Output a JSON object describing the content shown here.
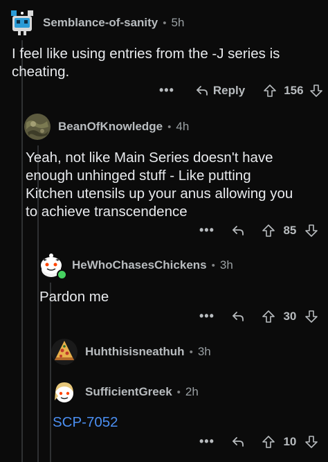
{
  "comments": [
    {
      "username": "Semblance-of-sanity",
      "time": "5h",
      "body_lines": [
        "I feel like using entries from the -J series is",
        "cheating."
      ],
      "reply_label": "Reply",
      "score": "156",
      "avatar": "robot-avatar"
    },
    {
      "username": "BeanOfKnowledge",
      "time": "4h",
      "body_lines": [
        "Yeah, not like Main Series doesn't have",
        "enough unhinged stuff - Like putting",
        "Kitchen utensils up your anus allowing you",
        "to achieve transcendence"
      ],
      "score": "85",
      "avatar": "camo-avatar"
    },
    {
      "username": "HeWhoChasesChickens",
      "time": "3h",
      "body_lines": [
        "Pardon me"
      ],
      "score": "30",
      "avatar": "snoo-avatar"
    },
    {
      "username": "Huhthisisneathuh",
      "time": "3h",
      "avatar": "pizza-avatar"
    },
    {
      "username": "SufficientGreek",
      "time": "2h",
      "body_lines": [
        "SCP-7052"
      ],
      "score": "10",
      "avatar": "blonde-snoo-avatar"
    }
  ],
  "more_label": "•••",
  "colors": {
    "background": "#0b0b0b",
    "username": "#b8bcbf",
    "body": "#e8eaed",
    "link": "#4b8ff2",
    "online": "#46d160",
    "thread_line": "#2f3133"
  }
}
